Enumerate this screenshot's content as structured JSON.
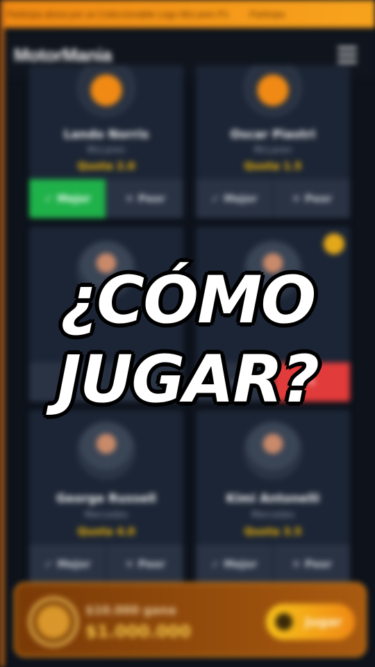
{
  "ticker": [
    "Participa ahora por un Coleccionable Lego McLaren P1",
    "Participa"
  ],
  "header": {
    "logo": "MotorMania"
  },
  "drivers": [
    {
      "name": "Lando Norris",
      "team": "McLaren",
      "odds": "Quota 2.0",
      "win_label": "Mejor",
      "loss_label": "Peor",
      "selected": "win"
    },
    {
      "name": "Oscar Piastri",
      "team": "McLaren",
      "odds": "Quota 1.5",
      "win_label": "Mejor",
      "loss_label": "Peor",
      "selected": "none"
    },
    {
      "name": "",
      "team": "",
      "odds": "",
      "win_label": "",
      "loss_label": "",
      "selected": "none"
    },
    {
      "name": "",
      "team": "",
      "odds": "",
      "win_label": "",
      "loss_label": "",
      "selected": "loss"
    },
    {
      "name": "George Russell",
      "team": "Mercedes",
      "odds": "Quota 4.0",
      "win_label": "Mejor",
      "loss_label": "Peor",
      "selected": "none"
    },
    {
      "name": "Kimi Antonelli",
      "team": "Mercedes",
      "odds": "Quota 3.5",
      "win_label": "Mejor",
      "loss_label": "Peor",
      "selected": "none"
    }
  ],
  "footer": {
    "prize_label": "$10.000 gana",
    "prize_amount": "$1.000.000",
    "play_label": "Jugar"
  },
  "overlay": {
    "line1": "¿CÓMO",
    "line2": "JUGAR?"
  },
  "colors": {
    "accent": "#f08a14",
    "win": "#1fb14a",
    "loss": "#e23b3b",
    "odds": "#f2b705"
  }
}
